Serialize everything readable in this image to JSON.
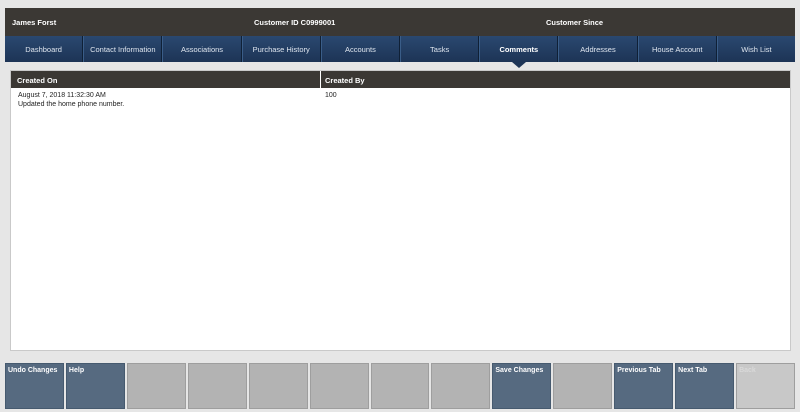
{
  "header": {
    "customer_name": "James Forst",
    "customer_id": "Customer ID  C0999001",
    "customer_since": "Customer Since"
  },
  "tabs": [
    {
      "label": "Dashboard"
    },
    {
      "label": "Contact Information"
    },
    {
      "label": "Associations"
    },
    {
      "label": "Purchase History"
    },
    {
      "label": "Accounts"
    },
    {
      "label": "Tasks"
    },
    {
      "label": "Comments"
    },
    {
      "label": "Addresses"
    },
    {
      "label": "House Account"
    },
    {
      "label": "Wish List"
    }
  ],
  "active_tab": "Comments",
  "table": {
    "headers": {
      "created_on": "Created On",
      "created_by": "Created By"
    },
    "rows": [
      {
        "created_on": "August 7, 2018 11:32:30 AM",
        "comment": "Updated the home phone number.",
        "created_by": "100"
      }
    ]
  },
  "buttons": [
    {
      "label": "Undo Changes"
    },
    {
      "label": "Help"
    },
    {
      "label": ""
    },
    {
      "label": ""
    },
    {
      "label": ""
    },
    {
      "label": ""
    },
    {
      "label": ""
    },
    {
      "label": ""
    },
    {
      "label": "Save Changes"
    },
    {
      "label": ""
    },
    {
      "label": "Previous Tab"
    },
    {
      "label": "Next Tab"
    },
    {
      "label": "Back"
    }
  ]
}
